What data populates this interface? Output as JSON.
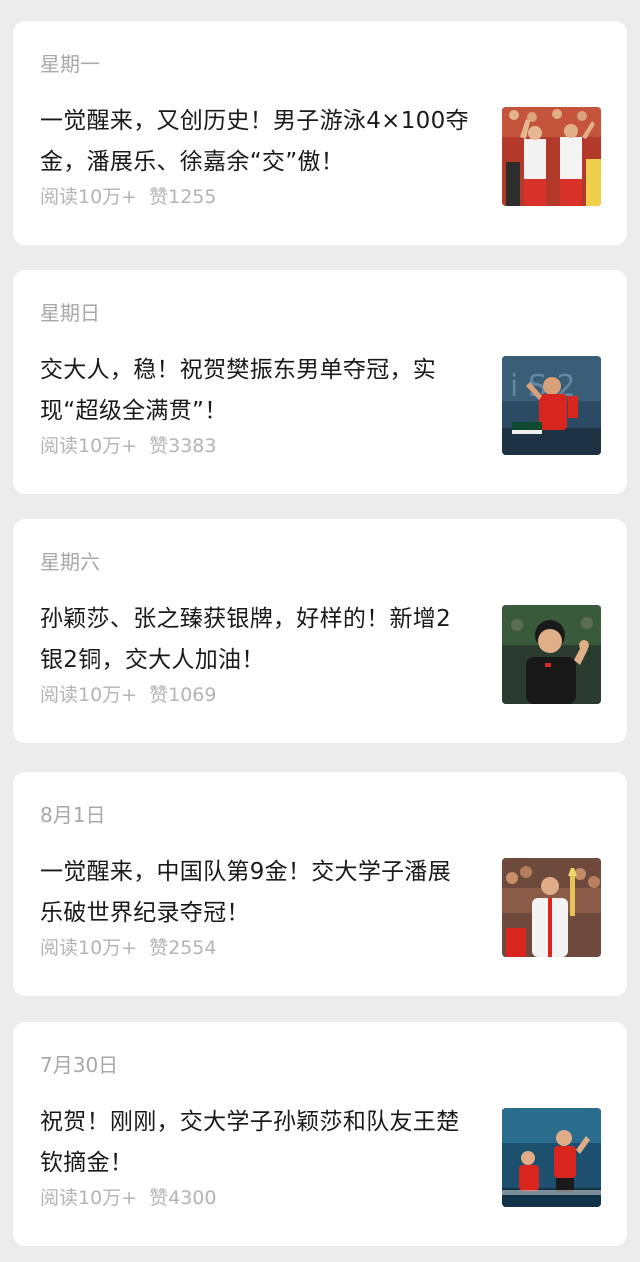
{
  "articles": [
    {
      "date": "星期一",
      "title": "一觉醒来，又创历史！男子游泳4×100夺金，潘展乐、徐嘉余“交”傲！",
      "reads": "阅读10万+",
      "likes": "赞1255",
      "thumb_icon": "swimmers-celebrating-photo"
    },
    {
      "date": "星期日",
      "title": "交大人，稳！祝贺樊振东男单夺冠，实现“超级全满贯”！",
      "reads": "阅读10万+",
      "likes": "赞3383",
      "thumb_icon": "table-tennis-player-photo"
    },
    {
      "date": "星期六",
      "title": "孙颖莎、张之臻获银牌，好样的！新增2银2铜，交大人加油！",
      "reads": "阅读10万+",
      "likes": "赞1069",
      "thumb_icon": "athlete-fist-pump-photo"
    },
    {
      "date": "8月1日",
      "title": "一觉醒来，中国队第9金！交大学子潘展乐破世界纪录夺冠！",
      "reads": "阅读10万+",
      "likes": "赞2554",
      "thumb_icon": "swimmer-with-torch-photo"
    },
    {
      "date": "7月30日",
      "title": "祝贺！刚刚，交大学子孙颖莎和队友王楚钦摘金！",
      "reads": "阅读10万+",
      "likes": "赞4300",
      "thumb_icon": "mixed-doubles-table-tennis-photo"
    }
  ],
  "colors": {
    "background": "#ececec",
    "card": "#ffffff",
    "title_text": "#1a1a1a",
    "meta_text": "#a8a8a8"
  }
}
